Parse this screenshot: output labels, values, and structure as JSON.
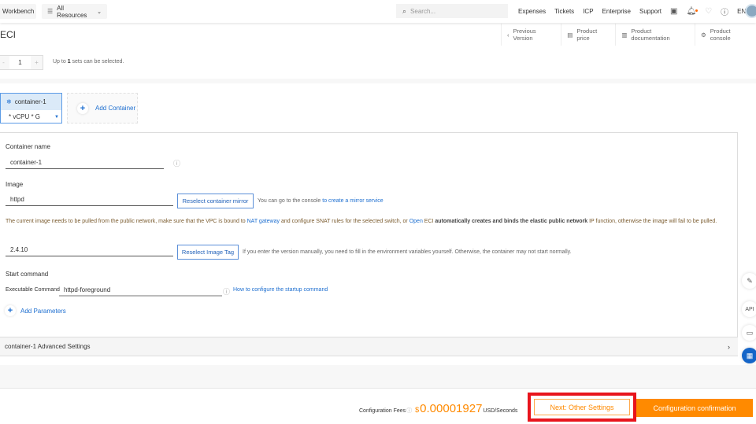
{
  "topbar": {
    "workbench": "Workbench",
    "all_resources": "All Resources",
    "search_placeholder": "Search...",
    "links": [
      "Expenses",
      "Tickets",
      "ICP",
      "Enterprise",
      "Support"
    ],
    "lang": "EN"
  },
  "page": {
    "title": "ECI"
  },
  "right_tabs": [
    "Previous Version",
    "Product price",
    "Product documentation",
    "Product console"
  ],
  "quantity": {
    "value": "1",
    "note_prefix": "Up to ",
    "note_count": "1",
    "note_suffix": " sets can be selected."
  },
  "container_tab": {
    "name": "container-1",
    "spec": "* vCPU * G",
    "add_label": "Add Container"
  },
  "form": {
    "container_name_label": "Container name",
    "container_name_value": "container-1",
    "image_label": "Image",
    "image_value": "httpd",
    "reselect_mirror": "Reselect container mirror",
    "mirror_hint": "You can go to the console ",
    "mirror_link": "to create a mirror service",
    "warn_1": "The current image needs to be pulled from the public network, make sure that the VPC is bound to ",
    "warn_link1": "NAT gateway",
    "warn_2": " and configure SNAT rules for the selected switch, or ",
    "warn_link2": "Open",
    "warn_3": " ECI ",
    "warn_bold": "automatically creates and binds the elastic public network",
    "warn_4": " IP function, otherwise the image will fail to be pulled.",
    "tag_value": "2.4.10",
    "reselect_tag": "Reselect Image Tag",
    "tag_hint": "If you enter the version manually, you need to fill in the environment variables yourself. Otherwise, the container may not start normally.",
    "start_label": "Start command",
    "exec_label": "Executable Command",
    "exec_value": "httpd-foreground",
    "startup_link": "How to configure the startup command",
    "add_params": "Add Parameters"
  },
  "advanced": {
    "label": "container-1 Advanced Settings"
  },
  "footer": {
    "fees_label": "Configuration Fees",
    "currency": "$",
    "price": "0.00001927",
    "unit": "USD/Seconds",
    "next": "Next: Other Settings",
    "confirm": "Configuration confirmation"
  },
  "side_buttons": {
    "api": "API"
  },
  "colors": {
    "accent": "#ff8a00",
    "link": "#1e6fd0",
    "highlight": "#e8141c"
  }
}
